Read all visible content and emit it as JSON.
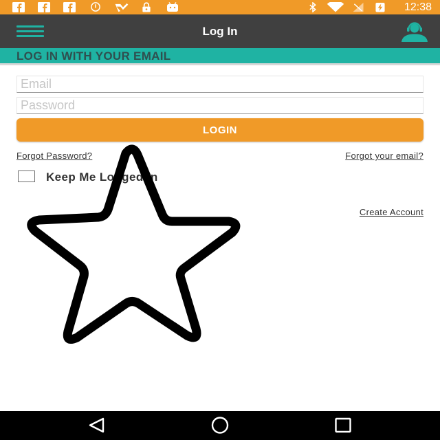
{
  "status_bar": {
    "time": "12:38",
    "left_icons": [
      "facebook-icon",
      "facebook-icon",
      "facebook-icon",
      "do-not-disturb-icon",
      "app-icon",
      "lock-icon",
      "android-icon"
    ],
    "right_icons": [
      "bluetooth-icon",
      "wifi-icon",
      "no-signal-icon",
      "battery-charging-icon"
    ],
    "background": "#f09a28"
  },
  "toolbar": {
    "title": "Log In",
    "menu_icon": "hamburger-menu-icon",
    "right_icon": "support-agent-icon",
    "background": "#404040",
    "accent": "#1fb3a3"
  },
  "section_header": {
    "title": "LOG IN WITH YOUR EMAIL",
    "background": "#1fb3a3"
  },
  "form": {
    "email": {
      "placeholder": "Email",
      "value": ""
    },
    "password": {
      "placeholder": "Password",
      "value": ""
    },
    "login_label": "LOGIN",
    "login_color": "#f09a28",
    "forgot_password": "Forgot Password?",
    "forgot_email": "Forgot your email?",
    "keep_logged_in": "Keep Me Logged In",
    "keep_logged_in_checked": false,
    "create_account": "Create Account"
  },
  "overlay": {
    "shape": "star-outline-icon"
  },
  "nav_bar": {
    "buttons": [
      "back-icon",
      "home-icon",
      "recents-icon"
    ]
  }
}
